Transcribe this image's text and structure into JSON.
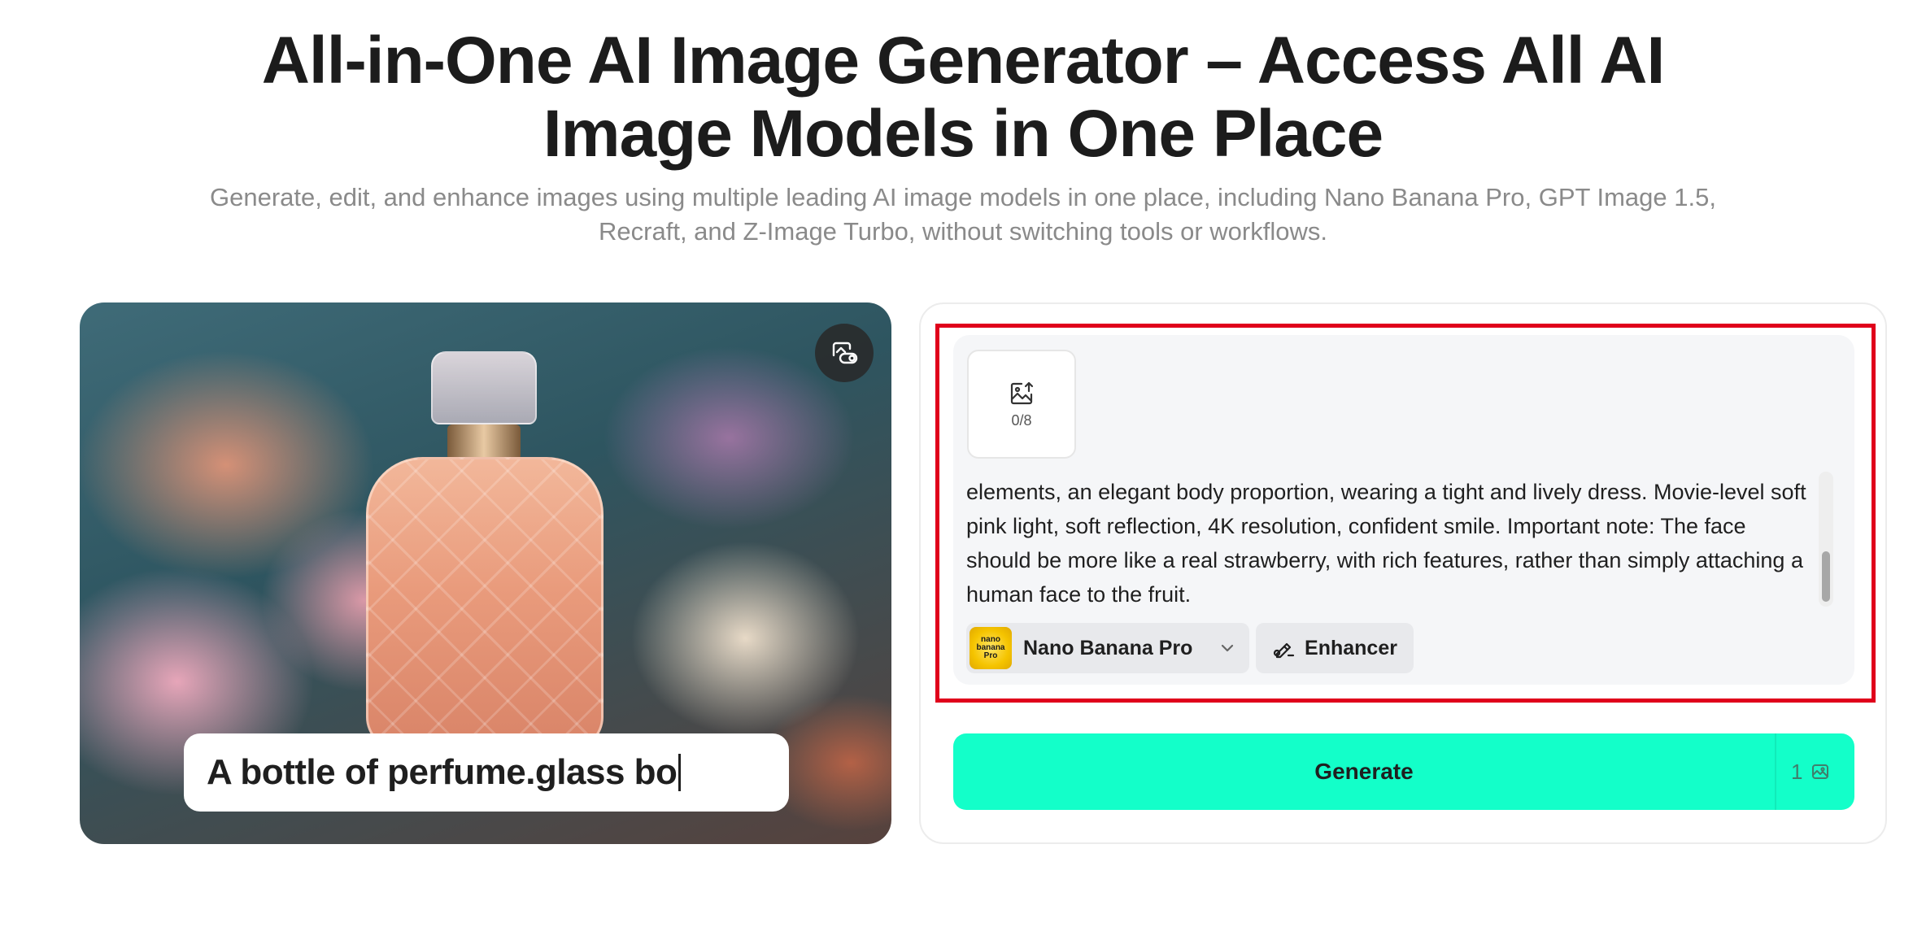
{
  "hero": {
    "title": "All-in-One AI Image Generator – Access All AI Image Models in One Place",
    "subtitle": "Generate, edit, and enhance images using multiple leading AI image models in one place, including Nano Banana Pro, GPT Image 1.5, Recraft, and Z-Image Turbo, without switching tools or workflows."
  },
  "preview": {
    "caption": "A bottle of perfume.glass bo",
    "toggle_icon": "toggle-icon"
  },
  "prompt": {
    "upload_count": "0/8",
    "upload_icon": "image-upload-icon",
    "text": "elements, an elegant body proportion, wearing a tight and lively dress. Movie-level soft pink light, soft reflection, 4K resolution, confident smile. Important note: The face should be more like a real strawberry, with rich features, rather than simply attaching a human face to the fruit."
  },
  "model": {
    "logo_text": "nano banana Pro",
    "name": "Nano Banana Pro"
  },
  "enhancer": {
    "label": "Enhancer"
  },
  "generate": {
    "label": "Generate",
    "credits": "1"
  },
  "colors": {
    "accent": "#13ffc9",
    "highlight": "#e0001b"
  }
}
